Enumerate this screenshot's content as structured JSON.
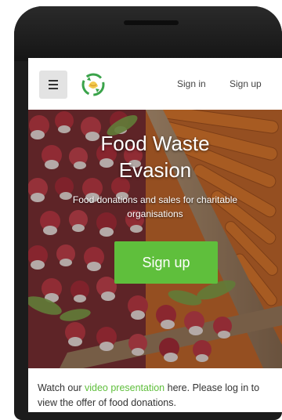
{
  "navbar": {
    "signin_label": "Sign in",
    "signup_label": "Sign up"
  },
  "hero": {
    "title_line1": "Food Waste",
    "title_line2": "Evasion",
    "subtitle": "Food donations and sales for charitable organisations",
    "cta_label": "Sign up"
  },
  "intro": {
    "text_before": "Watch our ",
    "link_label": "video presentation",
    "text_after": " here. Please log in to view the offer of food donations."
  },
  "colors": {
    "accent_green": "#5fbf3c",
    "device_frame": "#1c1c1c"
  },
  "icons": {
    "menu": "hamburger-icon",
    "logo": "recycle-hands-logo"
  }
}
